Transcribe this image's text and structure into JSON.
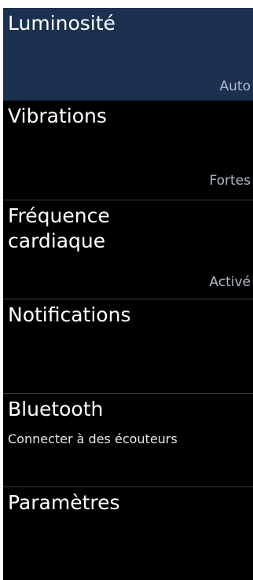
{
  "menu": {
    "items": [
      {
        "title": "Luminosité",
        "value": "Auto"
      },
      {
        "title": "Vibrations",
        "value": "Fortes"
      },
      {
        "title": "Fréquence cardiaque",
        "value": "Activé"
      },
      {
        "title": "Notifications"
      },
      {
        "title": "Bluetooth",
        "subtitle": "Connecter à des écouteurs"
      },
      {
        "title": "Paramètres"
      }
    ]
  },
  "colors": {
    "background": "#000000",
    "selected_row": "#1c3150",
    "value_text": "#aeb9c8",
    "divider": "#3a3a3a"
  }
}
